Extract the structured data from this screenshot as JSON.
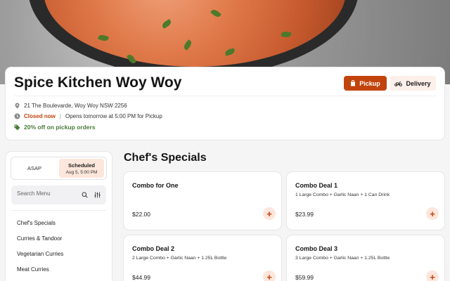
{
  "restaurant": {
    "name": "Spice Kitchen Woy Woy",
    "address": "21 The Boulevarde, Woy Woy NSW 2256",
    "status": "Closed now",
    "hours_note": "Opens tomorrow at 5:00 PM for Pickup",
    "promo": "20% off on pickup orders"
  },
  "order_mode": {
    "pickup_label": "Pickup",
    "delivery_label": "Delivery"
  },
  "timing": {
    "asap_label": "ASAP",
    "scheduled_label": "Scheduled",
    "scheduled_time": "Aug 5, 5:00 PM"
  },
  "search": {
    "placeholder": "Search Menu"
  },
  "categories": [
    "Chef's Specials",
    "Curries & Tandoor",
    "Vegetarian Curries",
    "Meat Curries"
  ],
  "section": {
    "title": "Chef's Specials"
  },
  "items": [
    {
      "name": "Combo for One",
      "desc": "",
      "price": "$22.00"
    },
    {
      "name": "Combo Deal 1",
      "desc": "1 Large Combo + Garlic Naan + 1 Can Drink",
      "price": "$23.99"
    },
    {
      "name": "Combo Deal 2",
      "desc": "2 Large Combo + Garlic Naan + 1.25L Bottle",
      "price": "$44.99"
    },
    {
      "name": "Combo Deal 3",
      "desc": "3 Large Combo + Garlic Naan + 1.25L Bottle",
      "price": "$59.99"
    }
  ],
  "colors": {
    "accent": "#c2440d",
    "accent_soft": "#fde6dc",
    "promo_green": "#4a7a3a"
  },
  "icons": {
    "pickup": "shopping-bag-icon",
    "delivery": "scooter-icon",
    "location": "map-pin-icon",
    "clock": "clock-icon",
    "promo": "tag-icon",
    "search": "search-icon",
    "filter": "filter-icon",
    "add": "plus-icon"
  }
}
